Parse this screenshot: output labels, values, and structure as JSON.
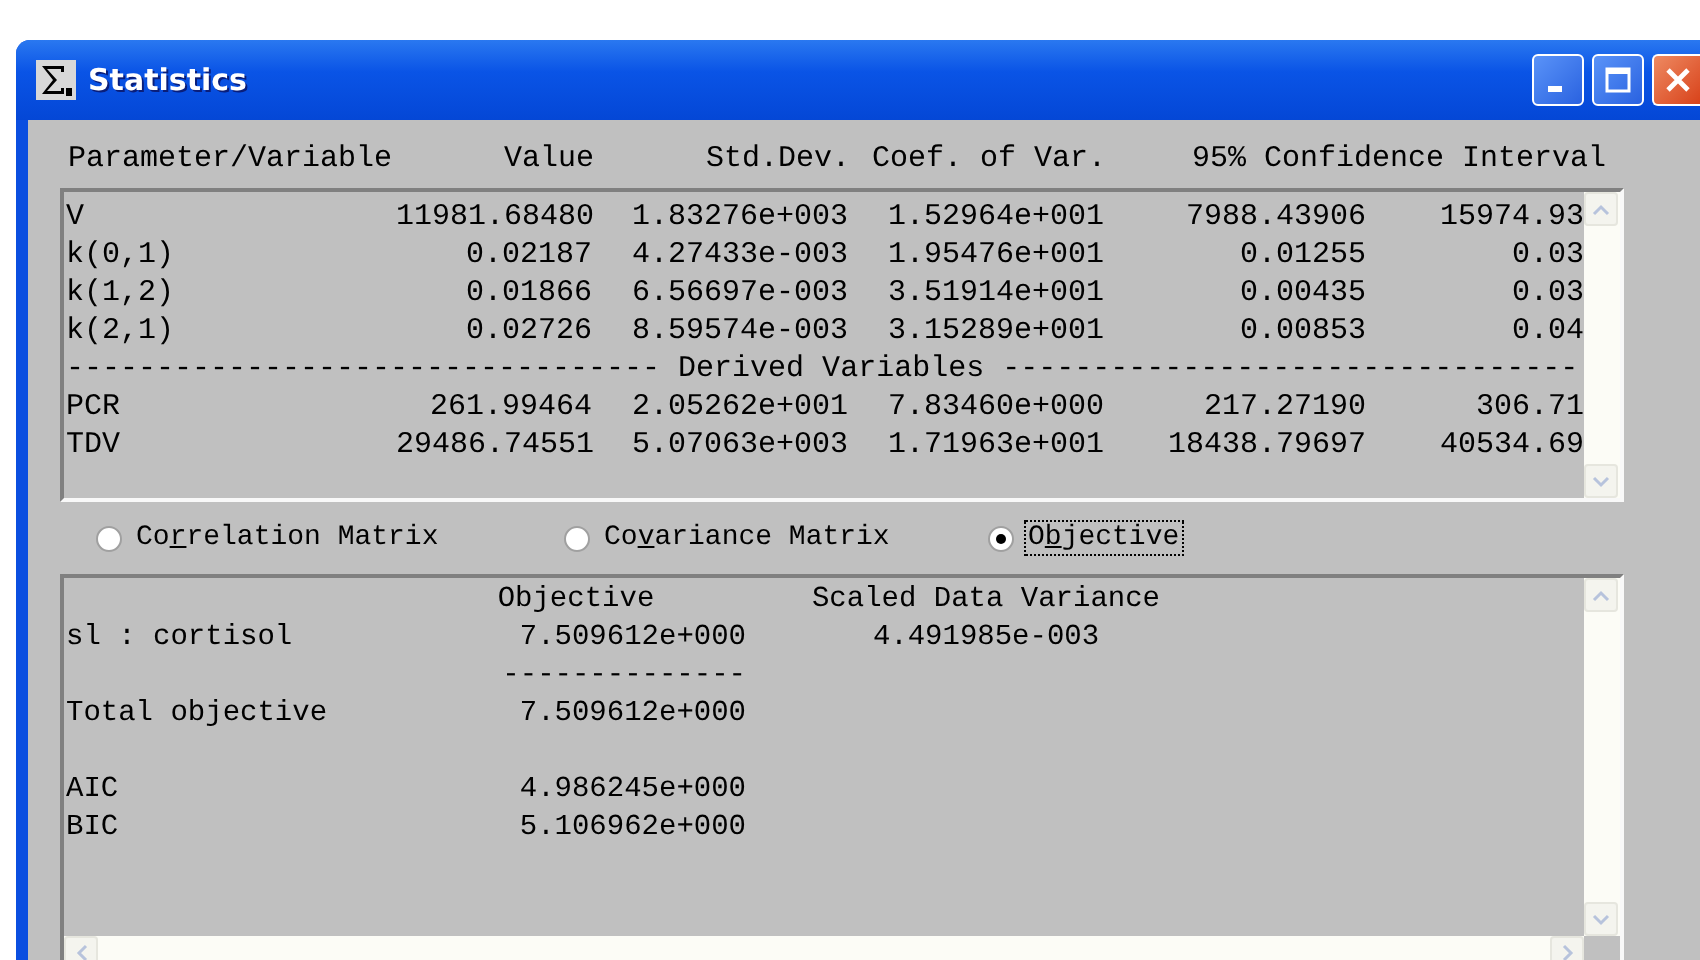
{
  "window": {
    "title": "Statistics"
  },
  "parameters": {
    "columns": [
      "Parameter/Variable",
      "Value",
      "Std.Dev.",
      "Coef. of Var.",
      "95% Confidence Interval"
    ],
    "rows": [
      {
        "kind": "row",
        "cells": [
          "V",
          "11981.68480",
          "1.83276e+003",
          "1.52964e+001",
          "7988.43906",
          "15974.93"
        ]
      },
      {
        "kind": "row",
        "cells": [
          "k(0,1)",
          "0.02187",
          "4.27433e-003",
          "1.95476e+001",
          "0.01255",
          "0.03"
        ]
      },
      {
        "kind": "row",
        "cells": [
          "k(1,2)",
          "0.01866",
          "6.56697e-003",
          "3.51914e+001",
          "0.00435",
          "0.03"
        ]
      },
      {
        "kind": "row",
        "cells": [
          "k(2,1)",
          "0.02726",
          "8.59574e-003",
          "3.15289e+001",
          "0.00853",
          "0.04"
        ]
      },
      {
        "kind": "separator",
        "text": "--------------------------------- Derived Variables --------------------------------"
      },
      {
        "kind": "row",
        "cells": [
          "PCR",
          "261.99464",
          "2.05262e+001",
          "7.83460e+000",
          "217.27190",
          "306.71"
        ]
      },
      {
        "kind": "row",
        "cells": [
          "TDV",
          "29486.74551",
          "5.07063e+003",
          "1.71963e+001",
          "18438.79697",
          "40534.69"
        ]
      }
    ]
  },
  "view_options": [
    {
      "label": {
        "before": "Co",
        "key": "r",
        "after": "relation Matrix"
      },
      "selected": false,
      "focused": false
    },
    {
      "label": {
        "before": "Co",
        "key": "v",
        "after": "ariance Matrix"
      },
      "selected": false,
      "focused": false
    },
    {
      "label": {
        "before": "O",
        "key": "b",
        "after": "jective"
      },
      "selected": true,
      "focused": true
    }
  ],
  "objective": {
    "columns": [
      "Objective",
      "Scaled Data Variance"
    ],
    "rows": [
      {
        "kind": "row",
        "cells": [
          "sl : cortisol",
          "7.509612e+000",
          "4.491985e-003"
        ]
      },
      {
        "kind": "rule",
        "text": "--------------"
      },
      {
        "kind": "row",
        "cells": [
          "Total objective",
          "7.509612e+000"
        ]
      },
      {
        "kind": "blank"
      },
      {
        "kind": "row",
        "cells": [
          "AIC",
          "4.986245e+000"
        ]
      },
      {
        "kind": "row",
        "cells": [
          "BIC",
          "5.106962e+000"
        ]
      }
    ]
  }
}
